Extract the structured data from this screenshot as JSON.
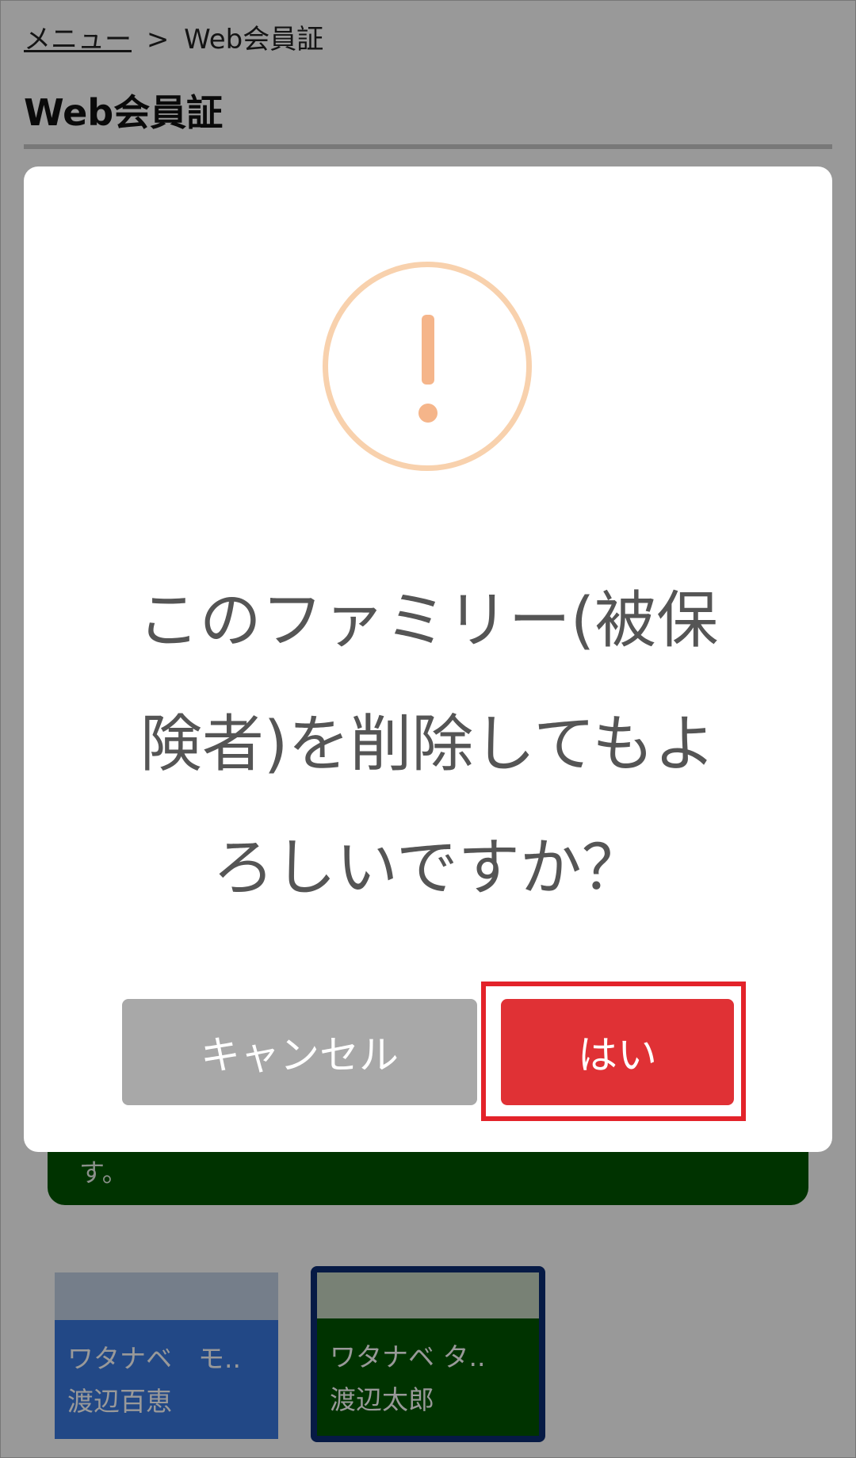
{
  "breadcrumb": {
    "menu_link": "メニュー",
    "separator": ">",
    "current": "Web会員証"
  },
  "page_title": "Web会員証",
  "notice": {
    "text_fragment": "す。"
  },
  "cards": [
    {
      "kana": "ワタナベ　モ..",
      "name": "渡辺百恵"
    },
    {
      "kana": "ワタナベ タ..",
      "name": "渡辺太郎"
    }
  ],
  "dialog": {
    "icon": "exclamation-warning-icon",
    "message_lines": [
      "このファミリー(被保",
      "険者)を削除してもよ",
      "ろしいですか？"
    ],
    "cancel_label": "キャンセル",
    "confirm_label": "はい"
  },
  "colors": {
    "overlay": "#000000",
    "warning_icon": "#f5b58a",
    "confirm_button": "#e03135",
    "cancel_button": "#a8a8a8",
    "highlight": "#e3232a",
    "notice_box": "#005500",
    "card_selected_border": "#0a2c73"
  }
}
